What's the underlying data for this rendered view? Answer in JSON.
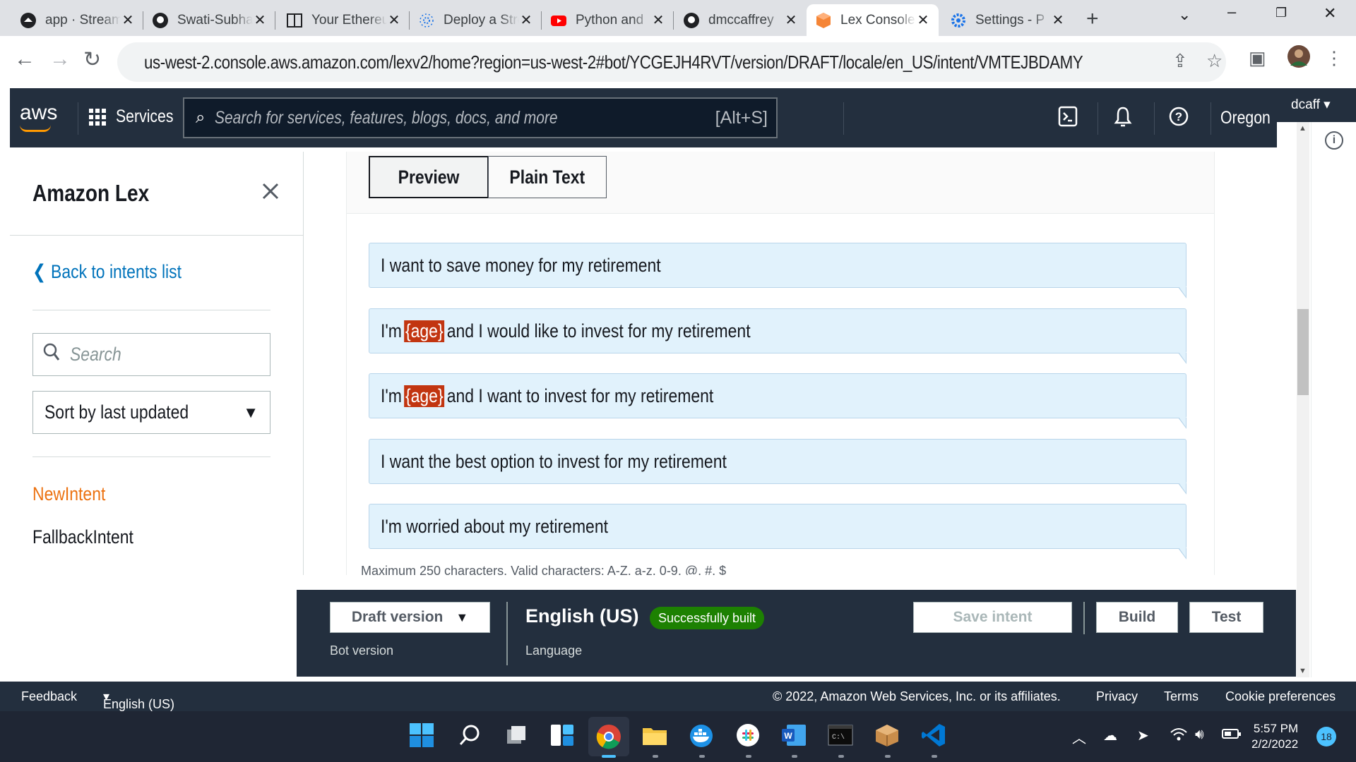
{
  "browser": {
    "tabs": [
      {
        "title": "app · Streamlit",
        "icon": "streamlit-icon"
      },
      {
        "title": "Swati-Subhash",
        "icon": "github-icon"
      },
      {
        "title": "Your Ethereum",
        "icon": "book-icon"
      },
      {
        "title": "Deploy a Streamlit",
        "icon": "streamlit-share-icon"
      },
      {
        "title": "Python and",
        "icon": "youtube-icon"
      },
      {
        "title": "dmccaffrey",
        "icon": "github-icon"
      },
      {
        "title": "Lex Console",
        "icon": "lex-icon"
      },
      {
        "title": "Settings - P",
        "icon": "settings-icon"
      }
    ],
    "active_tab_index": 6,
    "url": "us-west-2.console.aws.amazon.com/lexv2/home?region=us-west-2#bot/YCGEJH4RVT/version/DRAFT/locale/en_US/intent/VMTEJBDAMY"
  },
  "aws_nav": {
    "logo": "aws",
    "services": "Services",
    "search_placeholder": "Search for services, features, blogs, docs, and more",
    "search_shortcut": "[Alt+S]",
    "region": "Oregon",
    "user": "dcaff"
  },
  "sidebar": {
    "title": "Amazon Lex",
    "back_link": "Back to intents list",
    "search_placeholder": "Search",
    "sort_label": "Sort by last updated",
    "intents": [
      {
        "name": "NewIntent",
        "active": true
      },
      {
        "name": "FallbackIntent",
        "active": false
      }
    ]
  },
  "main": {
    "view_tabs": [
      {
        "label": "Preview",
        "active": true
      },
      {
        "label": "Plain Text",
        "active": false
      }
    ],
    "utterances": [
      {
        "parts": [
          "I want to save money for my retirement"
        ]
      },
      {
        "parts": [
          "I'm",
          "{age}",
          "and I would like to invest for my retirement"
        ]
      },
      {
        "parts": [
          "I'm",
          "{age}",
          "and I want to invest for my retirement"
        ]
      },
      {
        "parts": [
          "I want the best option to invest for my retirement"
        ]
      },
      {
        "parts": [
          "I'm worried about my retirement"
        ]
      }
    ],
    "hint": "Maximum 250 characters. Valid characters: A-Z, a-z, 0-9, @, #, $"
  },
  "bot_bar": {
    "version_select": "Draft version",
    "version_label": "Bot version",
    "language": "English (US)",
    "language_label": "Language",
    "build_status": "Successfully built",
    "save_button": "Save intent",
    "build_button": "Build",
    "test_button": "Test"
  },
  "footer": {
    "feedback": "Feedback",
    "language": "English (US)",
    "copyright": "© 2022, Amazon Web Services, Inc. or its affiliates.",
    "privacy": "Privacy",
    "terms": "Terms",
    "cookies": "Cookie preferences"
  },
  "taskbar": {
    "time": "5:57 PM",
    "date": "2/2/2022",
    "notifications": "18"
  },
  "colors": {
    "aws_dark": "#232f3e",
    "aws_orange": "#ff9900",
    "link_blue": "#0073bb",
    "active_intent": "#ec7211",
    "slot_red": "#c23510",
    "success_green": "#1d8102",
    "utterance_bg": "#e1f2fc"
  }
}
